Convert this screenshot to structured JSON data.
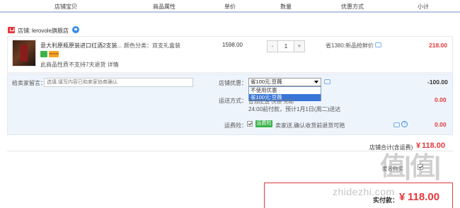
{
  "header": {
    "columns": [
      "店铺宝贝",
      "商品属性",
      "单价",
      "数量",
      "优惠方式",
      "小计"
    ]
  },
  "shop": {
    "label": "店铺:",
    "name": "lerovole旗舰店"
  },
  "item": {
    "title": "意大利原瓶原装进口红酒2支装...",
    "attribute": "颜色分类：双支礼盒装",
    "return_note": "此商品性质不支持7天退货 详情",
    "unit_price": "1598.00",
    "quantity": "1",
    "qty_minus": "-",
    "qty_plus": "+",
    "promotion": "省1380:新品抢鲜价",
    "subtotal": "218.00"
  },
  "options": {
    "memo_label": "给卖家留言：",
    "memo_placeholder": "选填:填写内容已和卖家协商确认",
    "coupon_label": "店铺优惠：",
    "coupon_selected": "省100元:豆薇",
    "coupon_options": [
      "不使用优惠",
      "省100元:豆薇"
    ],
    "coupon_amount": "-100.00",
    "shipping_label": "运送方式：",
    "shipping_line1": "普通配送 快递 免邮",
    "shipping_line2": "24:00前付款，预计1月1日(周二)送达",
    "shipping_amount": "0.00",
    "insurance_label": "运费险：",
    "insurance_tag": "运费险",
    "insurance_text": "卖家送,确认收货前退货可赔",
    "insurance_amount": "0.00"
  },
  "total": {
    "label": "店铺合计(含运费)",
    "currency": "¥",
    "value": "118.00"
  },
  "footer": {
    "anonymous_label": "匿名购买",
    "pay_label": "实付款：",
    "pay_currency": "¥",
    "pay_value": "118.00",
    "watermark_big": "值|值|值",
    "watermark_small": "zhidezhi.com"
  },
  "colors": {
    "accent_red": "#e4393c",
    "panel_blue": "#eef4fc",
    "select_blue": "#3875d7",
    "green": "#3bb34a"
  }
}
